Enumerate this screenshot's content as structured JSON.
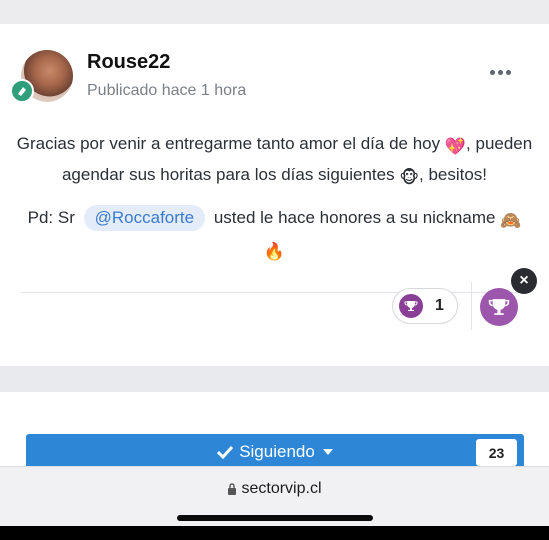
{
  "post": {
    "author": "Rouse22",
    "posted": "Publicado hace 1 hora",
    "line1": "Gracias por venir a entregarme tanto amor el día de hoy",
    "line2a": "pueden agendar sus horitas para los días siguientes",
    "line2b": ", besitos!",
    "line3a": "Pd: Sr",
    "mention": "@Roccaforte",
    "line3b": "usted le hace honores a su nickname",
    "emoji_heart": "💖",
    "emoji_monkey": "🐵",
    "emoji_see_no_evil": "🙈",
    "emoji_fire": "🔥"
  },
  "reactions": {
    "count": "1",
    "close_label": "×"
  },
  "follow": {
    "label": "Siguiendo",
    "count": "23"
  },
  "browser": {
    "url": "sectorvip.cl"
  },
  "colors": {
    "accent": "#2d87d6",
    "trophy": "#9c56ab",
    "mention_bg": "#e3ecf8",
    "mention_text": "#3b7bd0"
  }
}
